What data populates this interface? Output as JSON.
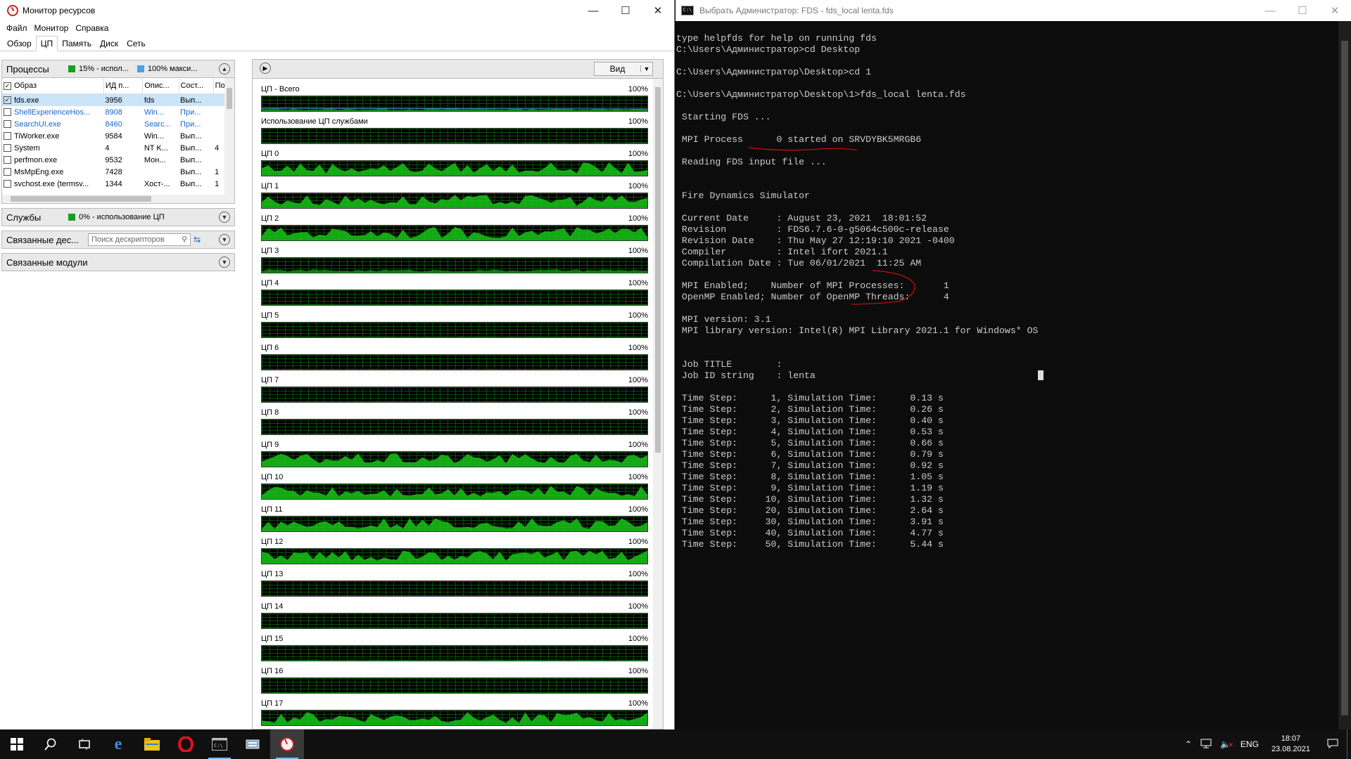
{
  "resource_monitor": {
    "title": "Монитор ресурсов",
    "menu": [
      "Файл",
      "Монитор",
      "Справка"
    ],
    "tabs": [
      "Обзор",
      "ЦП",
      "Память",
      "Диск",
      "Сеть"
    ],
    "active_tab": "ЦП",
    "processes": {
      "title": "Процессы",
      "stat1": "15% - испол...",
      "stat2": "100% макси...",
      "columns": [
        "Образ",
        "ИД п...",
        "Опис...",
        "Сост...",
        "Пот"
      ],
      "rows": [
        {
          "image": "fds.exe",
          "pid": "3956",
          "desc": "fds",
          "state": "Вып...",
          "threads": "",
          "checked": true,
          "highlight": true
        },
        {
          "image": "ShellExperienceHos...",
          "pid": "8908",
          "desc": "Win...",
          "state": "При...",
          "threads": "",
          "checked": false,
          "blue": true
        },
        {
          "image": "SearchUI.exe",
          "pid": "8460",
          "desc": "Searc...",
          "state": "При...",
          "threads": "",
          "checked": false,
          "blue": true
        },
        {
          "image": "TiWorker.exe",
          "pid": "9584",
          "desc": "Win...",
          "state": "Вып...",
          "threads": "",
          "checked": false
        },
        {
          "image": "System",
          "pid": "4",
          "desc": "NT K...",
          "state": "Вып...",
          "threads": "4",
          "checked": false
        },
        {
          "image": "perfmon.exe",
          "pid": "9532",
          "desc": "Мон...",
          "state": "Вып...",
          "threads": "",
          "checked": false
        },
        {
          "image": "MsMpEng.exe",
          "pid": "7428",
          "desc": "",
          "state": "Вып...",
          "threads": "1",
          "checked": false
        },
        {
          "image": "svchost.exe (termsv...",
          "pid": "1344",
          "desc": "Хост-...",
          "state": "Вып...",
          "threads": "1",
          "checked": false
        }
      ]
    },
    "services": {
      "title": "Службы",
      "stat": "0% - использование ЦП"
    },
    "handles": {
      "title": "Связанные дес...",
      "search_placeholder": "Поиск дескрипторов"
    },
    "modules": {
      "title": "Связанные модули"
    },
    "graphs_view_button": "Вид",
    "graphs": [
      {
        "label": "ЦП - Всего",
        "max": "100%"
      },
      {
        "label": "Использование ЦП службами",
        "max": "100%"
      },
      {
        "label": "ЦП 0",
        "max": "100%"
      },
      {
        "label": "ЦП 1",
        "max": "100%"
      },
      {
        "label": "ЦП 2",
        "max": "100%"
      },
      {
        "label": "ЦП 3",
        "max": "100%"
      },
      {
        "label": "ЦП 4",
        "max": "100%"
      },
      {
        "label": "ЦП 5",
        "max": "100%"
      },
      {
        "label": "ЦП 6",
        "max": "100%"
      },
      {
        "label": "ЦП 7",
        "max": "100%"
      },
      {
        "label": "ЦП 8",
        "max": "100%"
      },
      {
        "label": "ЦП 9",
        "max": "100%"
      },
      {
        "label": "ЦП 10",
        "max": "100%"
      },
      {
        "label": "ЦП 11",
        "max": "100%"
      },
      {
        "label": "ЦП 12",
        "max": "100%"
      },
      {
        "label": "ЦП 13",
        "max": "100%"
      },
      {
        "label": "ЦП 14",
        "max": "100%"
      },
      {
        "label": "ЦП 15",
        "max": "100%"
      },
      {
        "label": "ЦП 16",
        "max": "100%"
      },
      {
        "label": "ЦП 17",
        "max": "100%"
      }
    ]
  },
  "cmd": {
    "title": "Выбрать Администратор:  FDS - fds_local  lenta.fds",
    "icon_text": "C:\\",
    "lines": [
      "type helpfds for help on running fds",
      "C:\\Users\\Администратор>cd Desktop",
      "",
      "C:\\Users\\Администратор\\Desktop>cd 1",
      "",
      "C:\\Users\\Администратор\\Desktop\\1>fds_local lenta.fds",
      "",
      " Starting FDS ...",
      "",
      " MPI Process      0 started on SRVDYBK5MRGB6",
      "",
      " Reading FDS input file ...",
      "",
      "",
      " Fire Dynamics Simulator",
      "",
      " Current Date     : August 23, 2021  18:01:52",
      " Revision         : FDS6.7.6-0-g5064c500c-release",
      " Revision Date    : Thu May 27 12:19:10 2021 -0400",
      " Compiler         : Intel ifort 2021.1",
      " Compilation Date : Tue 06/01/2021  11:25 AM",
      "",
      " MPI Enabled;    Number of MPI Processes:       1",
      " OpenMP Enabled; Number of OpenMP Threads:      4",
      "",
      " MPI version: 3.1",
      " MPI library version: Intel(R) MPI Library 2021.1 for Windows* OS",
      "",
      "",
      " Job TITLE        :",
      " Job ID string    : lenta",
      "",
      " Time Step:      1, Simulation Time:      0.13 s",
      " Time Step:      2, Simulation Time:      0.26 s",
      " Time Step:      3, Simulation Time:      0.40 s",
      " Time Step:      4, Simulation Time:      0.53 s",
      " Time Step:      5, Simulation Time:      0.66 s",
      " Time Step:      6, Simulation Time:      0.79 s",
      " Time Step:      7, Simulation Time:      0.92 s",
      " Time Step:      8, Simulation Time:      1.05 s",
      " Time Step:      9, Simulation Time:      1.19 s",
      " Time Step:     10, Simulation Time:      1.32 s",
      " Time Step:     20, Simulation Time:      2.64 s",
      " Time Step:     30, Simulation Time:      3.91 s",
      " Time Step:     40, Simulation Time:      4.77 s",
      " Time Step:     50, Simulation Time:      5.44 s"
    ]
  },
  "taskbar": {
    "items": [
      "start-icon",
      "search-icon",
      "task-view-icon",
      "edge-icon",
      "explorer-icon",
      "opera-icon",
      "cmd-icon",
      "server-manager-icon",
      "resource-monitor-icon"
    ],
    "language": "ENG",
    "time": "18:07",
    "date": "23.08.2021"
  },
  "colors": {
    "graph_green": "#18c418",
    "graph_grid": "#0a4f0a",
    "link_blue": "#1a66cc",
    "annotation_red": "#cc1111"
  }
}
